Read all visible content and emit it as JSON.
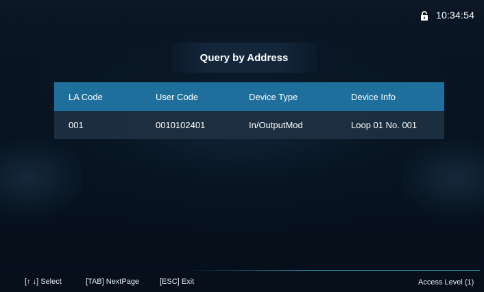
{
  "status_bar": {
    "lock_icon": "lock-open-icon",
    "time": "10:34:54"
  },
  "title": "Query by Address",
  "table": {
    "columns": [
      "LA Code",
      "User Code",
      "Device Type",
      "Device Info"
    ],
    "rows": [
      [
        "001",
        "0010102401",
        "In/OutputMod",
        "Loop 01 No. 001"
      ]
    ]
  },
  "footer": {
    "hints": [
      "[↑ ↓] Select",
      "[TAB] NextPage",
      "[ESC] Exit"
    ],
    "access_level": "Access Level  (1)"
  },
  "colors": {
    "background": "#06101c",
    "header_accent": "#1f6f9c",
    "row_background": "#1c2e40",
    "title_box": "#13263a"
  }
}
